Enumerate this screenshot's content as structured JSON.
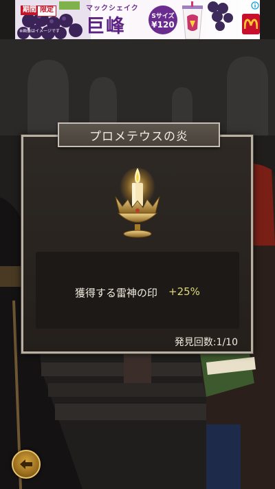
{
  "ad": {
    "tag_period": "期間",
    "tag_limited": "限定",
    "note": "※画像はイメージです",
    "tagline": "マックシェイク",
    "flavor": "巨峰",
    "size": "Sサイズ",
    "price": "¥120",
    "brand_icon": "mcdonalds-logo",
    "info_icon": "info-icon",
    "close_icon": "close-icon"
  },
  "dialog": {
    "title": "プロメテウスの炎",
    "item_icon": "candle-icon",
    "effect_label": "獲得する雷神の印",
    "effect_value": "+25%",
    "discovery_count": "発見回数:1/10"
  },
  "controls": {
    "back_icon": "back-arrow-icon"
  },
  "colors": {
    "panel_border": "#b9b0a4",
    "effect_value": "#e0d97b",
    "back_button": "#d7a53b",
    "ad_purple": "#5b2283",
    "ad_red": "#c8102e"
  }
}
